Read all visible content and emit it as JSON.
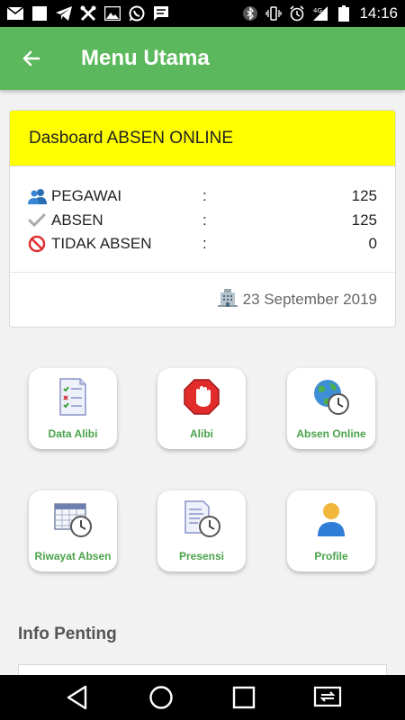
{
  "status_bar": {
    "time": "14:16",
    "network": "4G"
  },
  "app_bar": {
    "title": "Menu Utama",
    "back_icon": "arrow-left-icon"
  },
  "dashboard": {
    "header": "Dasboard ABSEN ONLINE",
    "rows": [
      {
        "label": "PEGAWAI",
        "sep": ":",
        "value": "125",
        "icon": "users-icon"
      },
      {
        "label": "ABSEN",
        "sep": ":",
        "value": "125",
        "icon": "check-icon"
      },
      {
        "label": "TIDAK ABSEN",
        "sep": ":",
        "value": "0",
        "icon": "no-entry-icon"
      }
    ],
    "date": "23 September 2019",
    "date_icon": "building-icon"
  },
  "menu": [
    {
      "label": "Data Alibi",
      "icon": "checklist-doc-icon"
    },
    {
      "label": "Alibi",
      "icon": "stop-hand-icon"
    },
    {
      "label": "Absen Online",
      "icon": "globe-clock-icon"
    },
    {
      "label": "Riwayat Absen",
      "icon": "calendar-clock-icon"
    },
    {
      "label": "Presensi",
      "icon": "document-clock-icon"
    },
    {
      "label": "Profile",
      "icon": "user-icon"
    }
  ],
  "info": {
    "title": "Info Penting"
  },
  "colors": {
    "primary": "#5cb85c",
    "header_yellow": "#ffff00",
    "label_green": "#4aa24a"
  }
}
